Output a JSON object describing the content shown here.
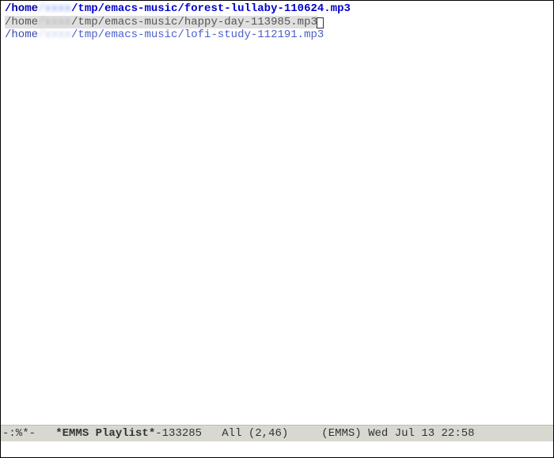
{
  "playlist": {
    "items": [
      {
        "prefix": "/home",
        "redacted": "/xxxx",
        "suffix": "/tmp/emacs-music/forest-lullaby-110624.mp3",
        "kind": "current"
      },
      {
        "prefix": "/home",
        "redacted": "/xxxx",
        "suffix": "/tmp/emacs-music/happy-day-113985.mp3",
        "kind": "selected"
      },
      {
        "prefix": "/home",
        "redacted": "/xxxx",
        "suffix": "/tmp/emacs-music/lofi-study-112191.mp3",
        "kind": "normal"
      }
    ]
  },
  "modeline": {
    "left": "-:%*-   ",
    "buffer_name": "*EMMS Playlist*",
    "buffer_suffix": "-133285",
    "position": "   All (2,46) ",
    "mode": "    (EMMS) ",
    "datetime": "Wed Jul 13 22:58"
  },
  "minibuffer": {
    "text": ""
  }
}
